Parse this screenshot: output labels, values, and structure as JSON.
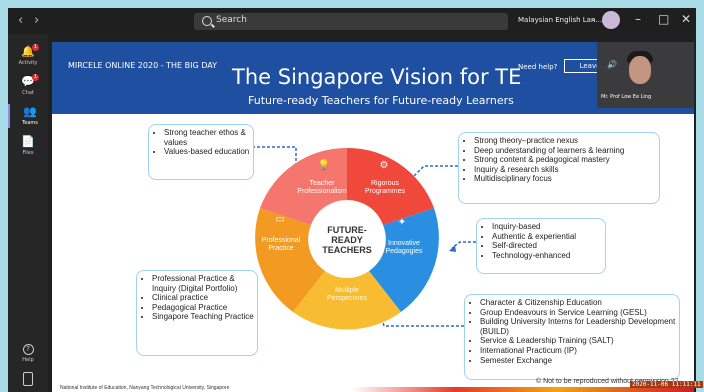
{
  "app": {
    "nav_back": "‹",
    "nav_forward": "›",
    "search_placeholder": "Search",
    "org": "Malaysian English Lan...",
    "window": {
      "minimize": "–",
      "maximize": "□",
      "close": "✕"
    }
  },
  "rail": [
    {
      "label": "Activity",
      "icon": "bell-icon",
      "glyph": "🔔",
      "badge": "1"
    },
    {
      "label": "Chat",
      "icon": "chat-icon",
      "glyph": "💬",
      "badge": "1"
    },
    {
      "label": "Teams",
      "icon": "teams-icon",
      "glyph": "👥",
      "badge": ""
    },
    {
      "label": "Files",
      "icon": "files-icon",
      "glyph": "📄",
      "badge": ""
    },
    {
      "label": "Help",
      "icon": "help-icon",
      "glyph": "?",
      "badge": ""
    }
  ],
  "meeting": {
    "conference": "MIRCELE ONLINE 2020 - THE BIG DAY",
    "need_help": "Need help?",
    "leave": "Leave",
    "participant": "Mr. Prof Low Ee Ling"
  },
  "slide": {
    "title": "The Singapore Vision for TE",
    "subtitle": "Future-ready Teachers for Future-ready Learners",
    "center": [
      "FUTURE-READY",
      "TEACHERS"
    ],
    "segments": [
      {
        "label": [
          "Teacher",
          "Professionalism"
        ],
        "color": "#f4766c"
      },
      {
        "label": [
          "Rigorous",
          "Programmes"
        ],
        "color": "#f0493c"
      },
      {
        "label": [
          "Innovative",
          "Pedagogies"
        ],
        "color": "#2a8fe0"
      },
      {
        "label": [
          "Multiple",
          "Perspectives"
        ],
        "color": "#f7bc32"
      },
      {
        "label": [
          "Professional",
          "Practice"
        ],
        "color": "#f29a22"
      }
    ],
    "boxes": {
      "ethos": [
        "Strong teacher ethos & values",
        "Values-based education"
      ],
      "programmes": [
        "Strong theory–practice nexus",
        "Deep understanding of learners & learning",
        "Strong content & pedagogical mastery",
        "Inquiry & research skills",
        "Multidisciplinary focus"
      ],
      "pedagogies": [
        "Inquiry-based",
        "Authentic & experiential",
        "Self-directed",
        "Technology-enhanced"
      ],
      "practice": [
        "Professional Practice & Inquiry (Digital Portfolio)",
        "Clinical practice",
        "Pedagogical Practice",
        "Singapore Teaching Practice"
      ],
      "perspectives": [
        "Character & Citizenship Education",
        "Group Endeavours in Service Learning (GESL)",
        "Building University Interns for Leadership Development (BUILD)",
        "Service & Leadership Training (SALT)",
        "International Practicum (IP)",
        "Semester Exchange"
      ]
    },
    "copyright": "© Not to be reproduced without permission 22",
    "institution": "National Institute of Education, Nanyang Technological University, Singapore",
    "timestamp": "2020-11-06  11:11:11"
  }
}
